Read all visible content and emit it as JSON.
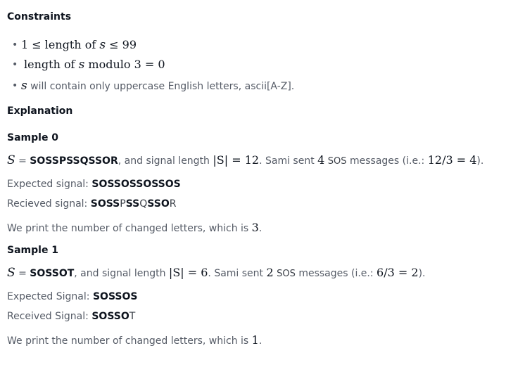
{
  "constraints": {
    "heading": "Constraints",
    "c1": {
      "pre": "1 ≤ ",
      "word": "length of ",
      "var": "s",
      "post": " ≤ 99"
    },
    "c2": {
      "word": "length of ",
      "var": "s",
      "mid": " modulo ",
      "post": "3 = 0"
    },
    "c3": {
      "var": "s",
      "text": " will contain only uppercase English letters, ascii[A-Z]."
    }
  },
  "explanation": {
    "heading": "Explanation"
  },
  "sample0": {
    "heading": "Sample 0",
    "S": "S",
    "eq": " = ",
    "value": "SOSSPSSQSSOR",
    "text1": ", and signal length ",
    "len_expr": "|S| = 12",
    "text2": ". Sami sent ",
    "count": "4",
    "sos": "SOS",
    "text3": " messages (i.e.: ",
    "calc": "12/3 = 4",
    "text4": ").",
    "expected_label": "Expected signal: ",
    "expected_value": "SOSSOSSOSSOS",
    "received_label": "Recieved signal: ",
    "received_parts": [
      "SOSS",
      "P",
      "SS",
      "Q",
      "SSO",
      "R"
    ],
    "result_text": "We print the number of changed letters, which is ",
    "result_value": "3",
    "result_end": "."
  },
  "sample1": {
    "heading": "Sample 1",
    "S": "S",
    "eq": " = ",
    "value": "SOSSOT",
    "text1": ", and signal length ",
    "len_expr": "|S| = 6",
    "text2": ". Sami sent ",
    "count": "2",
    "sos": "SOS",
    "text3": " messages (i.e.: ",
    "calc": "6/3 = 2",
    "text4": ").",
    "expected_label": "Expected Signal: ",
    "expected_value": "SOSSOS",
    "received_label": "Received Signal: ",
    "received_parts": [
      "SOSSO",
      "T"
    ],
    "result_text": "We print the number of changed letters, which is ",
    "result_value": "1",
    "result_end": "."
  }
}
